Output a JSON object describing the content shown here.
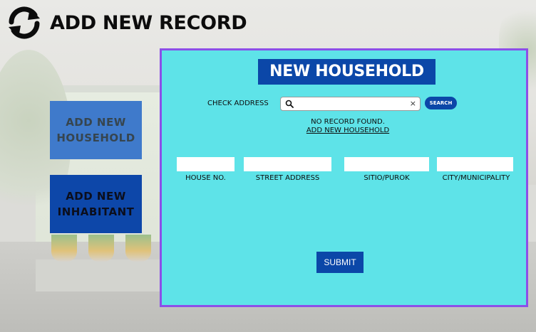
{
  "header": {
    "title": "ADD NEW RECORD",
    "icon": "refresh-icon"
  },
  "sidebar": {
    "add_household_label": "ADD NEW HOUSEHOLD",
    "add_inhabitant_label": "ADD NEW INHABITANT"
  },
  "panel": {
    "title": "NEW HOUSEHOLD",
    "check_address_label": "CHECK ADDRESS",
    "search_value": "",
    "search_button_label": "SEARCH",
    "clear_symbol": "×",
    "no_record_text": "NO RECORD FOUND.",
    "add_household_link": "ADD NEW HOUSEHOLD",
    "fields": [
      {
        "label": "HOUSE NO.",
        "value": ""
      },
      {
        "label": "STREET ADDRESS",
        "value": ""
      },
      {
        "label": "SITIO/PUROK",
        "value": ""
      },
      {
        "label": "CITY/MUNICIPALITY",
        "value": ""
      }
    ],
    "submit_label": "SUBMIT"
  },
  "colors": {
    "panel_bg": "#5ee3e8",
    "panel_border": "#8c4fe8",
    "primary": "#0b47a8",
    "household_button": "#3f7acb",
    "inhabitant_button": "#0d47a9"
  }
}
